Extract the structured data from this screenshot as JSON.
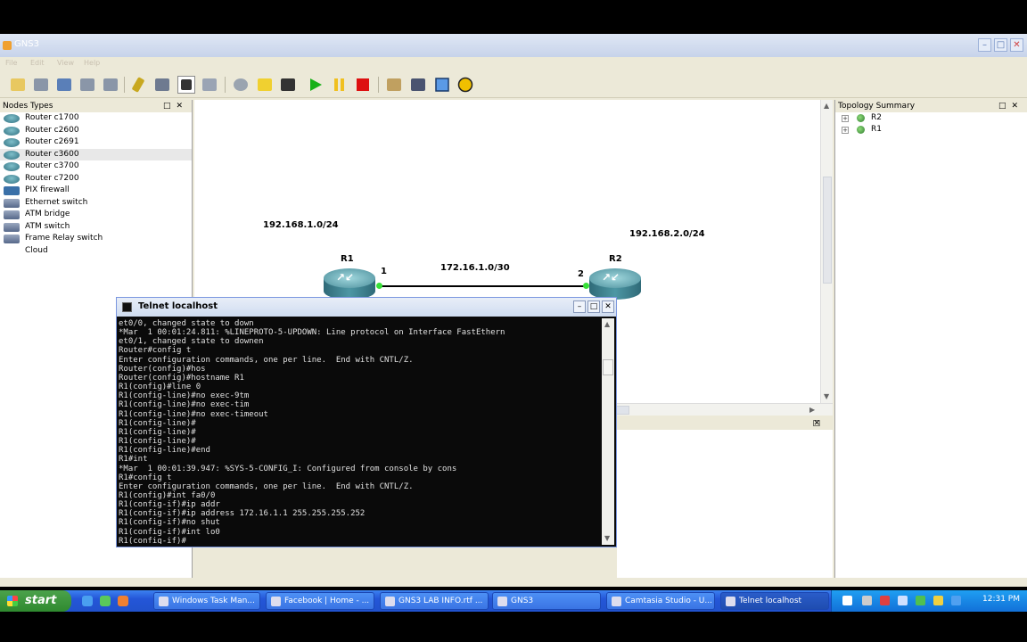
{
  "window": {
    "title": "GNS3"
  },
  "menu": [
    "File",
    "Edit",
    "View",
    "Help"
  ],
  "nodes_panel": {
    "title": "Nodes Types",
    "items": [
      {
        "label": "Router c1700",
        "icon": "router"
      },
      {
        "label": "Router c2600",
        "icon": "router"
      },
      {
        "label": "Router c2691",
        "icon": "router"
      },
      {
        "label": "Router c3600",
        "icon": "router",
        "selected": true
      },
      {
        "label": "Router c3700",
        "icon": "router"
      },
      {
        "label": "Router c7200",
        "icon": "router"
      },
      {
        "label": "PIX firewall",
        "icon": "firewall"
      },
      {
        "label": "Ethernet switch",
        "icon": "switch"
      },
      {
        "label": "ATM bridge",
        "icon": "switch"
      },
      {
        "label": "ATM switch",
        "icon": "switch"
      },
      {
        "label": "Frame Relay switch",
        "icon": "switch"
      },
      {
        "label": "Cloud",
        "icon": "cloud"
      }
    ]
  },
  "topology": {
    "networks": {
      "left": "192.168.1.0/24",
      "right": "192.168.2.0/24",
      "link": "172.16.1.0/30"
    },
    "r1": {
      "name": "R1",
      "port": "1"
    },
    "r2": {
      "name": "R2",
      "port": "2"
    }
  },
  "topology_summary": {
    "title": "Topology Summary",
    "items": [
      {
        "label": "R2"
      },
      {
        "label": "R1"
      }
    ]
  },
  "telnet": {
    "title": "Telnet localhost",
    "lines": [
      "et0/0, changed state to down",
      "*Mar  1 00:01:24.811: %LINEPROTO-5-UPDOWN: Line protocol on Interface FastEthern",
      "et0/1, changed state to downen",
      "Router#config t",
      "Enter configuration commands, one per line.  End with CNTL/Z.",
      "Router(config)#hos",
      "Router(config)#hostname R1",
      "R1(config)#line 0",
      "R1(config-line)#no exec-9tm",
      "R1(config-line)#no exec-tim",
      "R1(config-line)#no exec-timeout",
      "R1(config-line)#",
      "R1(config-line)#",
      "R1(config-line)#",
      "R1(config-line)#end",
      "R1#int",
      "*Mar  1 00:01:39.947: %SYS-5-CONFIG_I: Configured from console by cons",
      "R1#config t",
      "Enter configuration commands, one per line.  End with CNTL/Z.",
      "R1(config)#int fa0/0",
      "R1(config-if)#ip addr",
      "R1(config-if)#ip address 172.16.1.1 255.255.255.252",
      "R1(config-if)#no shut",
      "R1(config-if)#int lo0",
      "R1(config-if)#"
    ]
  },
  "taskbar": {
    "start": "start",
    "tasks": [
      {
        "label": "Windows Task Man..."
      },
      {
        "label": "Facebook | Home - ..."
      },
      {
        "label": "GNS3 LAB INFO.rtf ..."
      },
      {
        "label": "GNS3"
      },
      {
        "label": "Camtasia Studio - U..."
      },
      {
        "label": "Telnet localhost",
        "active": true
      }
    ],
    "clock": "12:31 PM"
  },
  "colors": {
    "taskbar": "#2456d8",
    "start": "#2f8a2f",
    "port": "#38e038",
    "router": "#4d97a4"
  }
}
